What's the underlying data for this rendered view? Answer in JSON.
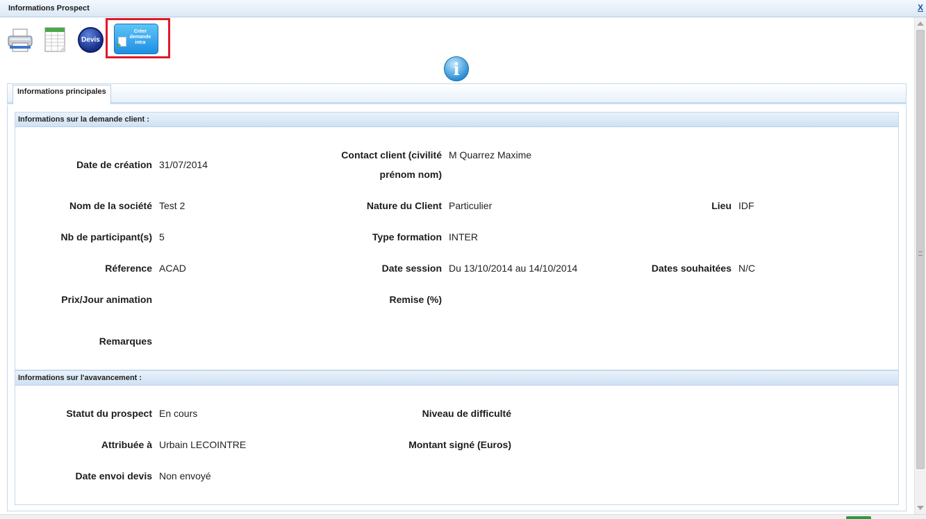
{
  "window": {
    "title": "Informations Prospect",
    "close_label": "X"
  },
  "toolbar": {
    "printer_icon": "printer-icon",
    "sheet_icon": "spreadsheet-icon",
    "devis_label": "Devis",
    "creer_label": "Créer demande intra",
    "highlight_color": "#e1182a"
  },
  "tabs": [
    {
      "label": "Informations principales",
      "active": true
    }
  ],
  "section1": {
    "title": "Informations sur la demande client :",
    "date_creation_label": "Date de création",
    "date_creation_value": "31/07/2014",
    "contact_label_line1": "Contact client (civilité",
    "contact_label_line2": "prénom nom)",
    "contact_value": "M Quarrez Maxime",
    "societe_label": "Nom de la société",
    "societe_value": "Test 2",
    "nature_label": "Nature du Client",
    "nature_value": "Particulier",
    "lieu_label": "Lieu",
    "lieu_value": "IDF",
    "participants_label": "Nb de participant(s)",
    "participants_value": "5",
    "type_label": "Type formation",
    "type_value": "INTER",
    "reference_label": "Réference",
    "reference_value": "ACAD",
    "session_label": "Date session",
    "session_value": "Du 13/10/2014 au 14/10/2014",
    "souhaitees_label": "Dates souhaitées",
    "souhaitees_value": "N/C",
    "prix_label": "Prix/Jour animation",
    "remise_label": "Remise (%)",
    "remarques_label": "Remarques"
  },
  "section2": {
    "title": "Informations sur l'avavancement :",
    "statut_label": "Statut du prospect",
    "statut_value": "En cours",
    "difficulte_label": "Niveau de difficulté",
    "attribuee_label": "Attribuée à",
    "attribuee_value": "Urbain LECOINTRE",
    "montant_label": "Montant signé (Euros)",
    "envoi_label": "Date envoi devis",
    "envoi_value": "Non envoyé"
  },
  "colors": {
    "accent": "#1d8ee3",
    "header_bg": "#dbe8f6"
  }
}
